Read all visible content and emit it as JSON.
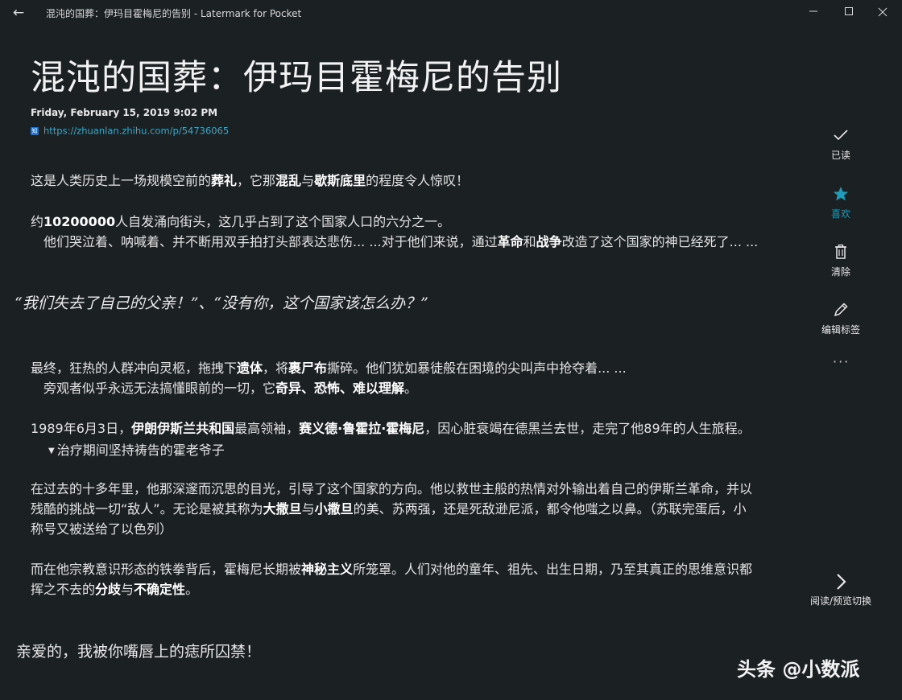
{
  "window": {
    "title": "混沌的国葬：伊玛目霍梅尼的告别 - Latermark for Pocket",
    "back_icon": "arrow-left-icon",
    "min_icon": "minimize-icon",
    "max_icon": "maximize-icon",
    "close_icon": "close-icon"
  },
  "article": {
    "title": "混沌的国葬：伊玛目霍梅尼的告别",
    "date": "Friday, February 15, 2019 9:02 PM",
    "site_icon_text": "知",
    "url": "https://zhuanlan.zhihu.com/p/54736065"
  },
  "body": {
    "p1": [
      "这是人类历史上一场规模空前的",
      "葬礼",
      "，它那",
      "混乱",
      "与",
      "歇斯底里",
      "的程度令人惊叹！"
    ],
    "p2": [
      "约",
      "10200000",
      "人自发涌向街头，这几乎占到了这个国家人口的六分之一。"
    ],
    "p3": [
      "他们哭泣着、呐喊着、并不断用双手拍打头部表达悲伤... ...对于他们来说，通过",
      "革命",
      "和",
      "战争",
      "改造了这个国家的神已经死了... ..."
    ],
    "quote": "“我们失去了自己的父亲！”、“没有你，这个国家该怎么办？”",
    "p4": [
      "最终，狂热的人群冲向灵柩，拖拽下",
      "遗体",
      "，将",
      "裹尸布",
      "撕碎。他们犹如暴徒般在困境的尖叫声中抢夺着... ..."
    ],
    "p5": [
      "旁观者似乎永远无法搞懂眼前的一切，它",
      "奇异、恐怖、难以理解",
      "。"
    ],
    "p6": [
      "1989年6月3日，",
      "伊朗伊斯兰共和国",
      "最高领袖，",
      "赛义德·鲁霍拉·霍梅尼",
      "，因心脏衰竭在德黑兰去世，走完了他89年的人生旅程。"
    ],
    "caption_marker": "▼",
    "caption": "治疗期间坚持祷告的霍老爷子",
    "p7a": "在过去的十多年里，他那深邃而沉思的目光，引导了这个国家的方向。他以救世主般的热情对外输出着自己的伊斯兰革命，并以",
    "p7b": [
      "残酷的挑战一切“敌人”。无论是被其称为",
      "大撒旦",
      "与",
      "小撒旦",
      "的美、苏两强，还是死敌逊尼派，都令他嗤之以鼻。（苏联完蛋后，小"
    ],
    "p7c": "称号又被送给了以色列）",
    "p8a": [
      "而在他宗教意识形态的铁拳背后，霍梅尼长期被",
      "神秘主义",
      "所笼罩。人们对他的童年、祖先、出生日期，乃至其真正的思维意识都"
    ],
    "p8b": [
      "挥之不去的",
      "分歧",
      "与",
      "不确定性",
      "。"
    ],
    "closing": "亲爱的，我被你嘴唇上的痣所囚禁！"
  },
  "sidebar": {
    "read": {
      "icon": "check-icon",
      "label": "已读"
    },
    "favorite": {
      "icon": "star-icon",
      "label": "喜欢",
      "color": "#1f9db8"
    },
    "delete": {
      "icon": "trash-icon",
      "label": "清除"
    },
    "edit_tags": {
      "icon": "pencil-icon",
      "label": "编辑标签"
    },
    "more": {
      "icon": "more-icon",
      "label": "···"
    },
    "toggle": {
      "icon": "chevron-right-icon",
      "label": "阅读/预览切换"
    }
  },
  "watermark": "头条 @小数派"
}
